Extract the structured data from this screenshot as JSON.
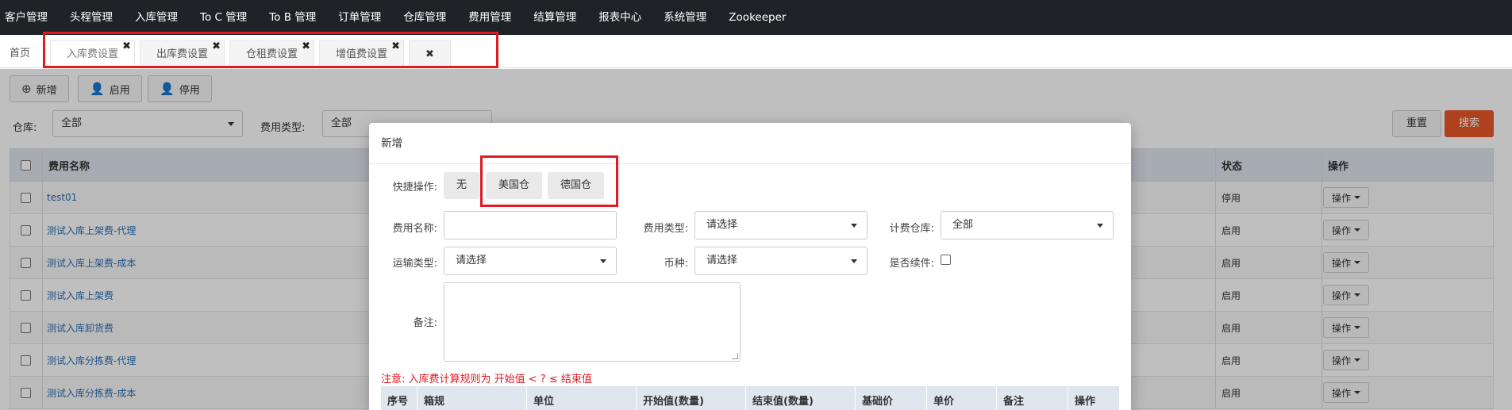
{
  "topnav": [
    "客户管理",
    "头程管理",
    "入库管理",
    "To C 管理",
    "To B 管理",
    "订单管理",
    "仓库管理",
    "费用管理",
    "结算管理",
    "报表中心",
    "系统管理",
    "Zookeeper"
  ],
  "tabs": {
    "home": "首页",
    "items": [
      "入库费设置",
      "出库费设置",
      "仓租费设置",
      "增值费设置"
    ],
    "close_glyph": "✖",
    "close_all_glyph": "✖"
  },
  "toolbar": {
    "add": "新增",
    "enable": "启用",
    "disable": "停用"
  },
  "filters": {
    "warehouse_label": "仓库:",
    "warehouse_value": "全部",
    "fee_type_label": "费用类型:",
    "fee_type_value": "全部",
    "reset": "重置",
    "search": "搜索"
  },
  "table": {
    "headers": {
      "name": "费用名称",
      "status": "状态",
      "action": "操作"
    },
    "rows": [
      {
        "name": "test01",
        "status": "停用",
        "action": "操作"
      },
      {
        "name": "测试入库上架费-代理",
        "status": "启用",
        "action": "操作"
      },
      {
        "name": "测试入库上架费-成本",
        "status": "启用",
        "action": "操作"
      },
      {
        "name": "测试入库上架费",
        "status": "启用",
        "action": "操作"
      },
      {
        "name": "测试入库卸货费",
        "status": "启用",
        "action": "操作"
      },
      {
        "name": "测试入库分拣费-代理",
        "status": "启用",
        "action": "操作"
      },
      {
        "name": "测试入库分拣费-成本",
        "status": "启用",
        "action": "操作"
      }
    ]
  },
  "modal": {
    "title": "新增",
    "quick_label": "快捷操作:",
    "quick_buttons": [
      "无",
      "美国仓",
      "德国仓"
    ],
    "fee_name_label": "费用名称:",
    "fee_type_label": "费用类型:",
    "fee_type_value": "请选择",
    "warehouse_label": "计费仓库:",
    "warehouse_value": "全部",
    "transport_label": "运输类型:",
    "transport_value": "请选择",
    "currency_label": "币种:",
    "currency_value": "请选择",
    "renew_label": "是否续件:",
    "remark_label": "备注:",
    "note": "注意:  入库费计算规则为 开始值 < ? ≤ 结束值",
    "rule_headers": [
      "序号",
      "箱规",
      "单位",
      "开始值(数量)",
      "结束值(数量)",
      "基础价",
      "单价",
      "备注",
      "操作"
    ]
  },
  "colors": {
    "navbar": "#1f2328",
    "accent": "#e8582a",
    "highlight": "#e01a22",
    "link": "#2a6fb4"
  }
}
